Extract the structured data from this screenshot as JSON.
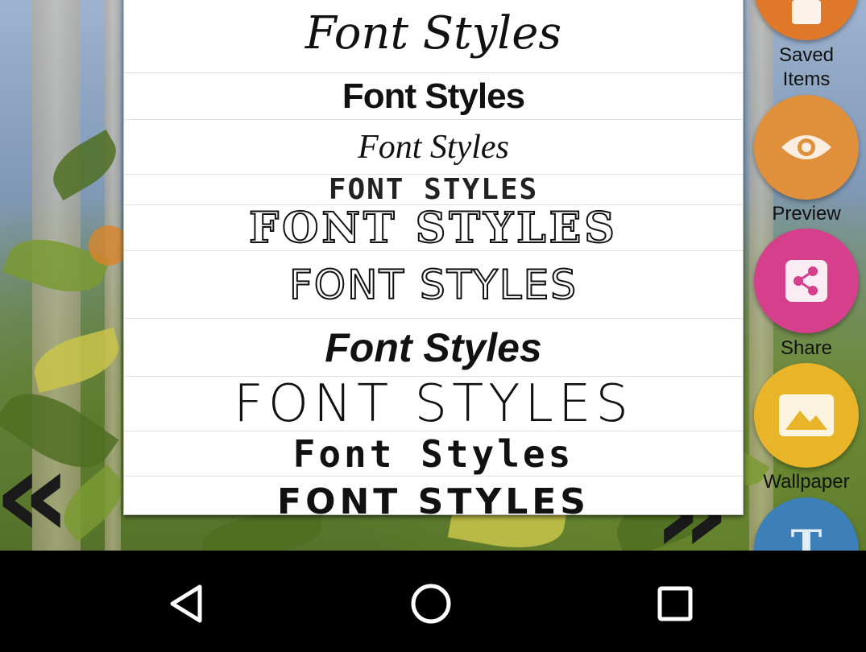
{
  "dialog": {
    "font_samples": [
      "Font Styles",
      "Font Styles",
      "Font Styles",
      "FONT STYLES",
      "FONT STYLES",
      "FONT STYLES",
      "Font Styles",
      "FONT STYLES",
      "Font Styles",
      "FONT STYLES"
    ]
  },
  "side_menu": {
    "items": [
      {
        "label": "Saved Items",
        "icon": "saved-items-icon",
        "color": "#e0782a"
      },
      {
        "label": "Preview",
        "icon": "eye-icon",
        "color": "#e0903a"
      },
      {
        "label": "Share",
        "icon": "share-icon",
        "color": "#d63f8c"
      },
      {
        "label": "Wallpaper",
        "icon": "image-icon",
        "color": "#e8b52a"
      },
      {
        "label": "",
        "icon": "text-icon",
        "color": "#3d7fb8"
      }
    ]
  },
  "background": {
    "back_chevron": "«"
  },
  "navbar": {
    "buttons": [
      "back",
      "home",
      "recents"
    ]
  }
}
